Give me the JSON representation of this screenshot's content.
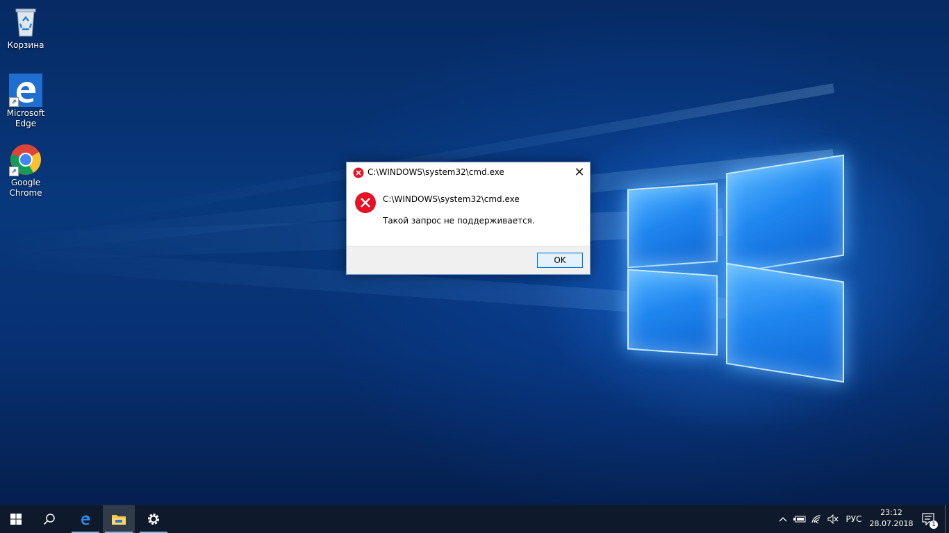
{
  "desktop": {
    "icons": [
      {
        "label": "Корзина",
        "icon": "recycle-bin-icon"
      },
      {
        "label": "Microsoft Edge",
        "icon": "edge-icon"
      },
      {
        "label": "Google Chrome",
        "icon": "chrome-icon"
      }
    ]
  },
  "dialog": {
    "title": "C:\\WINDOWS\\system32\\cmd.exe",
    "heading": "C:\\WINDOWS\\system32\\cmd.exe",
    "message": "Такой запрос не поддерживается.",
    "ok_label": "OK",
    "close_glyph": "✕",
    "icon": "error-icon",
    "error_color": "#e81123"
  },
  "taskbar": {
    "start_icon": "windows-start-icon",
    "search_icon": "search-icon",
    "pinned": [
      {
        "name": "Microsoft Edge",
        "icon": "edge-icon"
      },
      {
        "name": "File Explorer",
        "icon": "folder-icon"
      },
      {
        "name": "Settings",
        "icon": "gear-icon"
      }
    ],
    "tray": {
      "chevron_icon": "chevron-up-icon",
      "battery_icon": "battery-icon",
      "network_icon": "wifi-icon",
      "volume_icon": "volume-muted-icon",
      "language": "РУС",
      "time": "23:12",
      "date": "28.07.2018",
      "notifications_count": "1",
      "notifications_icon": "action-center-icon"
    },
    "accent": "#76b9ed"
  }
}
